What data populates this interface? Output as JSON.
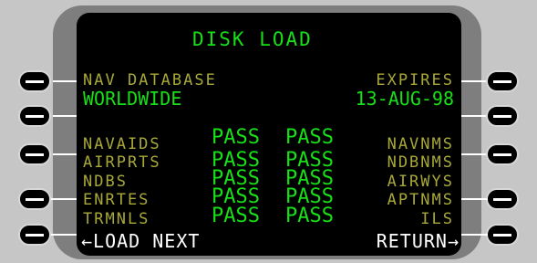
{
  "page": {
    "title": "DISK LOAD"
  },
  "header": {
    "left_label": "NAV DATABASE",
    "left_value": "WORLDWIDE",
    "right_label": "EXPIRES",
    "right_value": "13-AUG-98"
  },
  "rows": [
    {
      "name": "NAVAIDS",
      "status1": "PASS",
      "status2": "PASS",
      "right": "NAVNMS"
    },
    {
      "name": "AIRPRTS",
      "status1": "PASS",
      "status2": "PASS",
      "right": "NDBNMS"
    },
    {
      "name": "NDBS",
      "status1": "PASS",
      "status2": "PASS",
      "right": "AIRWYS"
    },
    {
      "name": "ENRTES",
      "status1": "PASS",
      "status2": "PASS",
      "right": "APTNMS"
    },
    {
      "name": "TRMNLS",
      "status1": "PASS",
      "status2": "PASS",
      "right": "ILS"
    }
  ],
  "soft_keys": {
    "left": "←LOAD NEXT",
    "right": "RETURN→"
  }
}
